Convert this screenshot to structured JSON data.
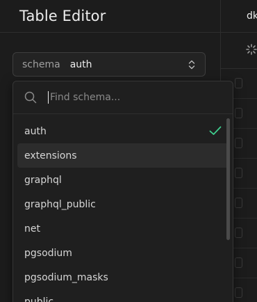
{
  "sidebar": {
    "title": "Table Editor",
    "schema_select": {
      "prefix": "schema",
      "value": "auth"
    }
  },
  "main": {
    "tab_label": "dk"
  },
  "dropdown": {
    "search_placeholder": "Find schema...",
    "selected": "auth",
    "hovered": "extensions",
    "options": [
      "auth",
      "extensions",
      "graphql",
      "graphql_public",
      "net",
      "pgsodium",
      "pgsodium_masks",
      "public"
    ]
  },
  "colors": {
    "background": "#1c1c1c",
    "accent_check": "#3ecf8e",
    "hover_row": "#2c2c2c"
  }
}
